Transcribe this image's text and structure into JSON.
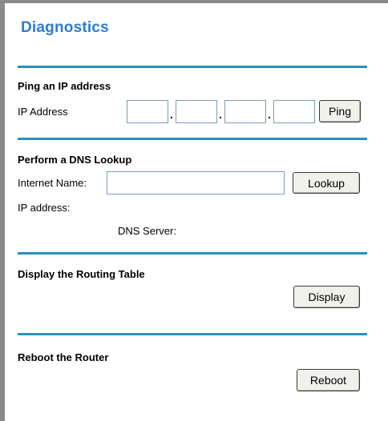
{
  "page": {
    "title": "Diagnostics"
  },
  "ping": {
    "heading": "Ping an IP address",
    "ip_label": "IP Address",
    "octets": [
      "",
      "",
      "",
      ""
    ],
    "dot": ".",
    "button": "Ping"
  },
  "dns": {
    "heading": "Perform a DNS Lookup",
    "name_label": "Internet Name:",
    "name_value": "",
    "button": "Lookup",
    "ip_label": "IP address:",
    "server_label": "DNS Server:"
  },
  "routing": {
    "heading": "Display the Routing Table",
    "button": "Display"
  },
  "reboot": {
    "heading": "Reboot the Router",
    "button": "Reboot"
  },
  "colors": {
    "title": "#2a7dd0",
    "rule": "#2a8fc0",
    "frame": "#8a8a8a"
  }
}
